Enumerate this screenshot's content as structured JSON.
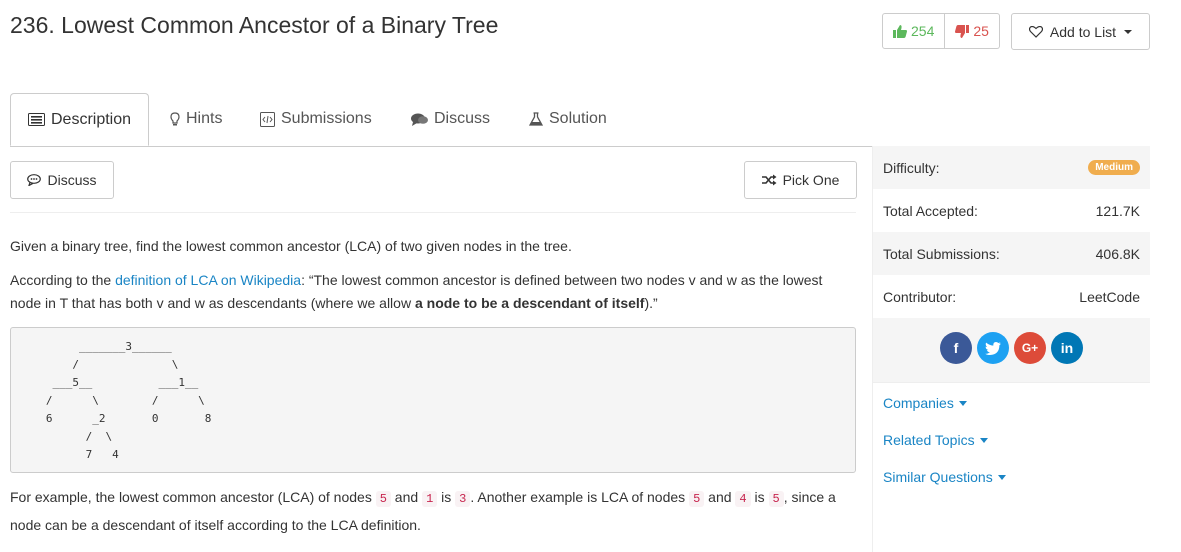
{
  "header": {
    "title": "236. Lowest Common Ancestor of a Binary Tree"
  },
  "votes": {
    "up": "254",
    "down": "25"
  },
  "add_to_list": "Add to List",
  "tabs": [
    {
      "label": "Description",
      "icon": "list-icon"
    },
    {
      "label": "Hints",
      "icon": "lightbulb-icon"
    },
    {
      "label": "Submissions",
      "icon": "code-file-icon"
    },
    {
      "label": "Discuss",
      "icon": "comments-icon"
    },
    {
      "label": "Solution",
      "icon": "flask-icon"
    }
  ],
  "buttons": {
    "discuss": "Discuss",
    "pick_one": "Pick One"
  },
  "content": {
    "p1": "Given a binary tree, find the lowest common ancestor (LCA) of two given nodes in the tree.",
    "p2_a": "According to the ",
    "p2_link": "definition of LCA on Wikipedia",
    "p2_b": ": “The lowest common ancestor is defined between two nodes v and w as the lowest node in T that has both v and w as descendants (where we allow ",
    "p2_bold": "a node to be a descendant of itself",
    "p2_c": ").”",
    "tree": "        _______3______\n       /              \\\n    ___5__          ___1__\n   /      \\        /      \\\n   6      _2       0       8\n         /  \\\n         7   4",
    "p3_a": "For example, the lowest common ancestor (LCA) of nodes ",
    "p3_c1": "5",
    "p3_b": " and ",
    "p3_c2": "1",
    "p3_c": " is ",
    "p3_c3": "3",
    "p3_d": ". Another example is LCA of nodes ",
    "p3_c4": "5",
    "p3_e": " and ",
    "p3_c5": "4",
    "p3_f": " is ",
    "p3_c6": "5",
    "p3_g": ", since a node can be a descendant of itself according to the LCA definition."
  },
  "sidebar": {
    "difficulty_label": "Difficulty:",
    "difficulty_value": "Medium",
    "accepted_label": "Total Accepted:",
    "accepted_value": "121.7K",
    "submissions_label": "Total Submissions:",
    "submissions_value": "406.8K",
    "contributor_label": "Contributor:",
    "contributor_value": "LeetCode",
    "social": [
      {
        "name": "facebook",
        "glyph": "f",
        "color": "#3b5998"
      },
      {
        "name": "twitter",
        "glyph": "t",
        "color": "#1da1f2"
      },
      {
        "name": "google-plus",
        "glyph": "G+",
        "color": "#dd4b39"
      },
      {
        "name": "linkedin",
        "glyph": "in",
        "color": "#0077b5"
      }
    ],
    "companies": "Companies",
    "related_topics": "Related Topics",
    "similar_questions": "Similar Questions"
  },
  "colors": {
    "link": "#1a85c5",
    "upvote": "#5cb85c",
    "downvote": "#d9534f",
    "medium_badge": "#f0ad4e"
  }
}
